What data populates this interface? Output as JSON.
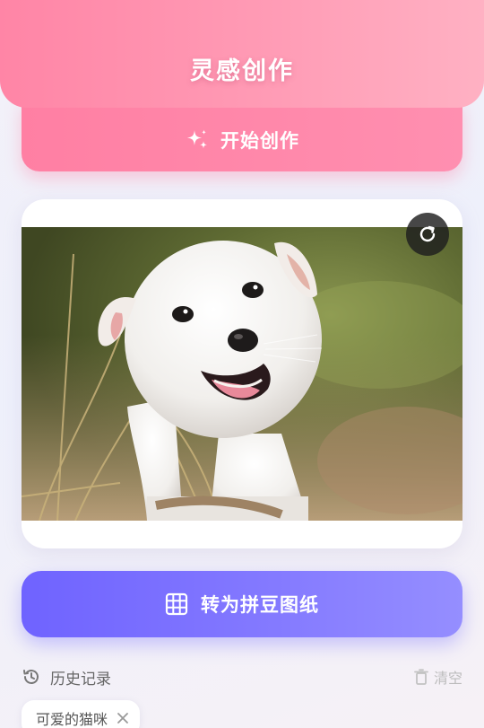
{
  "header": {
    "title": "灵感创作"
  },
  "start_button": {
    "label": "开始创作",
    "icon": "sparkles-icon"
  },
  "image_card": {
    "alt": "白色小狗",
    "refresh_icon": "refresh-icon"
  },
  "convert_button": {
    "label": "转为拼豆图纸",
    "icon": "grid-icon"
  },
  "history": {
    "title": "历史记录",
    "icon": "history-icon",
    "clear_label": "清空",
    "clear_icon": "trash-icon",
    "items": [
      {
        "label": "可爱的猫咪"
      }
    ]
  },
  "colors": {
    "header_pink": "#ff8fae",
    "start_pink": "#ff85a8",
    "convert_purple": "#7a70ff"
  }
}
